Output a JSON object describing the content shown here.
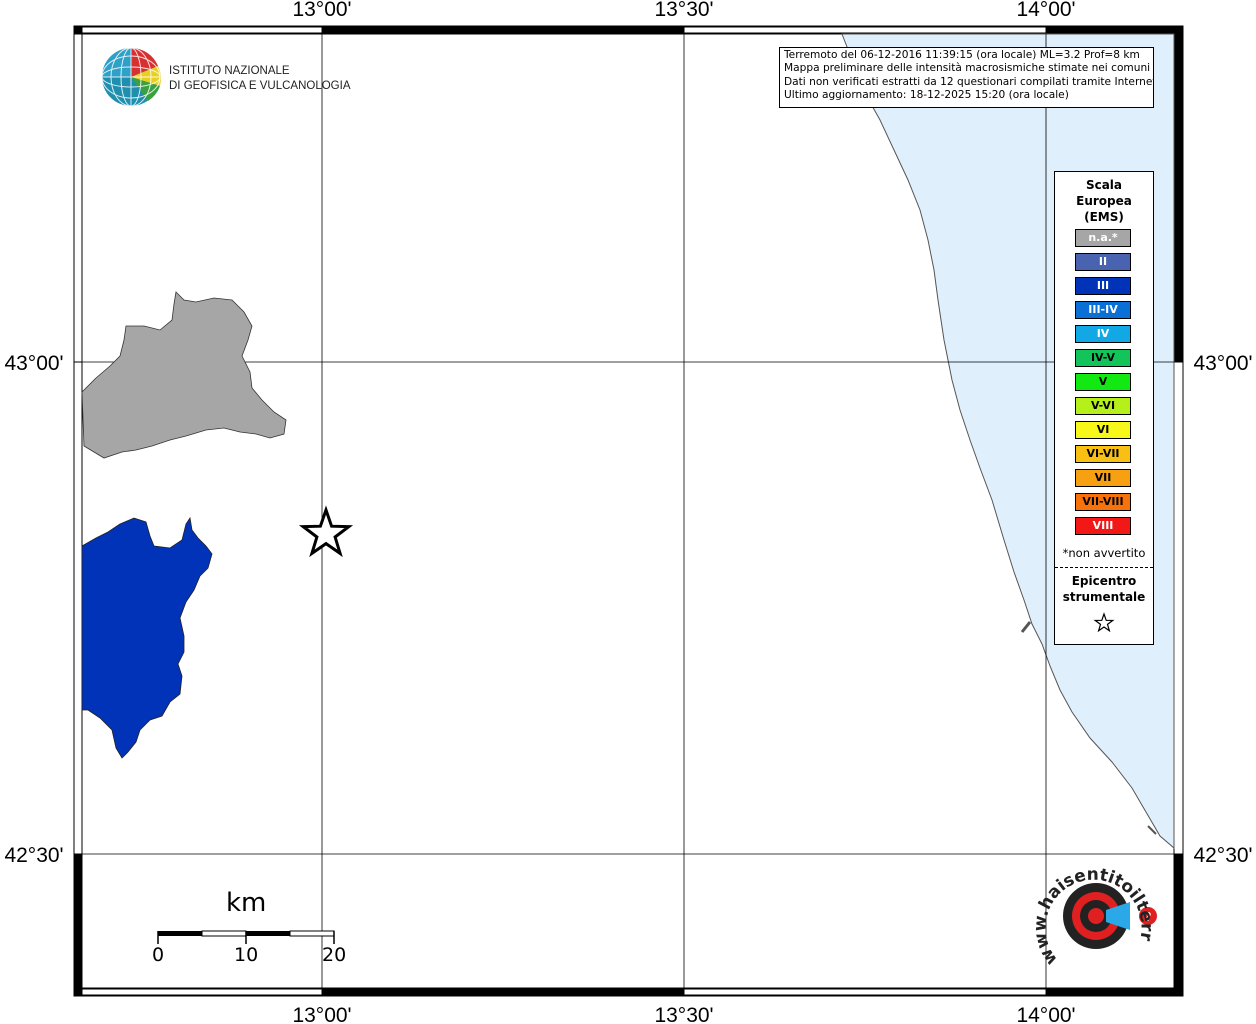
{
  "map": {
    "lon_labels": [
      "13°00'",
      "13°30'",
      "14°00'"
    ],
    "lat_labels": [
      "43°00'",
      "42°30'"
    ],
    "sea_color": "#dff0fc",
    "land_color": "#ffffff"
  },
  "institute": {
    "line1": "ISTITUTO NAZIONALE",
    "line2": "DI GEOFISICA E VULCANOLOGIA"
  },
  "info": {
    "line1": "Terremoto del 06-12-2016 11:39:15 (ora locale) ML=3.2 Prof=8 km",
    "line2": "Mappa preliminare delle intensità macrosismiche stimate nei comuni",
    "line3": "Dati non verificati estratti da 12 questionari compilati tramite Internet.",
    "line4": "Ultimo aggiornamento: 18-12-2025 15:20 (ora locale)"
  },
  "legend": {
    "title_line1": "Scala",
    "title_line2": "Europea",
    "title_line3": "(EMS)",
    "items": [
      {
        "label": "n.a.*",
        "color": "#a6a6a6",
        "text_color": "#ffffff"
      },
      {
        "label": "II",
        "color": "#4a63b0",
        "text_color": "#ffffff"
      },
      {
        "label": "III",
        "color": "#0033b8",
        "text_color": "#ffffff"
      },
      {
        "label": "III-IV",
        "color": "#0a70d6",
        "text_color": "#ffffff"
      },
      {
        "label": "IV",
        "color": "#12a8e6",
        "text_color": "#ffffff"
      },
      {
        "label": "IV-V",
        "color": "#12c45a",
        "text_color": "#000000"
      },
      {
        "label": "V",
        "color": "#12e812",
        "text_color": "#000000"
      },
      {
        "label": "V-VI",
        "color": "#b6f01a",
        "text_color": "#000000"
      },
      {
        "label": "VI",
        "color": "#f7f71a",
        "text_color": "#000000"
      },
      {
        "label": "VI-VII",
        "color": "#f7c012",
        "text_color": "#000000"
      },
      {
        "label": "VII",
        "color": "#f7a012",
        "text_color": "#000000"
      },
      {
        "label": "VII-VIII",
        "color": "#f7720a",
        "text_color": "#000000"
      },
      {
        "label": "VIII",
        "color": "#f21818",
        "text_color": "#ffffff"
      }
    ],
    "note": "*non avvertito",
    "epicenter_line1": "Epicentro",
    "epicenter_line2": "strumentale"
  },
  "scale_bar": {
    "unit": "km",
    "ticks": [
      "0",
      "10",
      "20"
    ]
  },
  "regions": [
    {
      "name": "municipality-north",
      "intensity": "n.a.*",
      "color": "#a6a6a6"
    },
    {
      "name": "municipality-south",
      "intensity": "III",
      "color": "#0033b8"
    }
  ],
  "brand": {
    "text": "www.haisentitoilterremoto.it"
  }
}
